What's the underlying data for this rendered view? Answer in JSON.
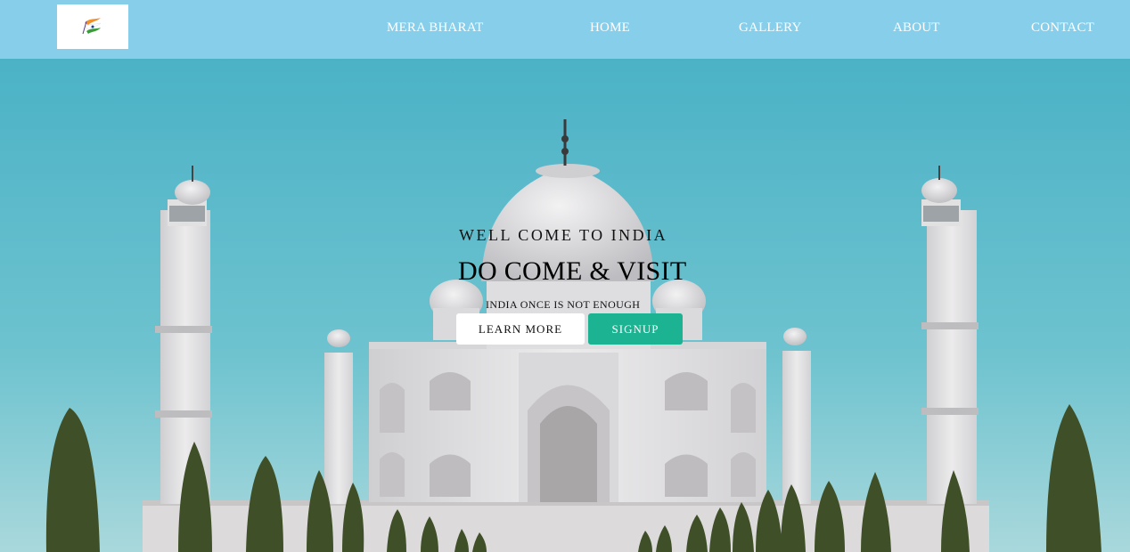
{
  "nav": {
    "brand": "MERA BHARAT",
    "links": [
      "HOME",
      "GALLERY",
      "ABOUT",
      "CONTACT"
    ]
  },
  "hero": {
    "welcome": "WELL COME TO INDIA",
    "headline": "DO COME & VISIT",
    "subline": "INDIA ONCE IS NOT ENOUGH",
    "learn_more": "LEARN MORE",
    "signup": "SIGNUP"
  },
  "colors": {
    "navbar": "#87ceeb",
    "sky": "#5bbccc",
    "signup": "#1bb391",
    "marble": "#e6e4e4",
    "trees": "#3f5028"
  },
  "icons": {
    "logo": "india-flag-ribbon-logo"
  }
}
